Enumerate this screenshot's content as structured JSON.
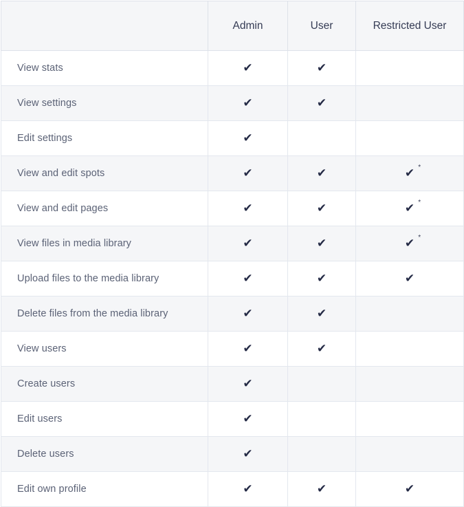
{
  "table": {
    "columns": [
      {
        "key": "feature",
        "label": ""
      },
      {
        "key": "admin",
        "label": "Admin"
      },
      {
        "key": "user",
        "label": "User"
      },
      {
        "key": "restricted",
        "label": "Restricted User"
      }
    ],
    "check_glyph": "✔",
    "footnote_marker": "*",
    "colors": {
      "header_background": "#f5f6f8",
      "row_alt_background": "#f5f6f8",
      "row_background": "#ffffff",
      "border": "#e3e7ee",
      "header_border": "#dde1e9",
      "header_text": "#343b54",
      "body_text": "#5b6276",
      "check_mark": "#252b46"
    },
    "rows": [
      {
        "feature": "View stats",
        "admin": "check",
        "user": "check",
        "restricted": ""
      },
      {
        "feature": "View settings",
        "admin": "check",
        "user": "check",
        "restricted": ""
      },
      {
        "feature": "Edit settings",
        "admin": "check",
        "user": "",
        "restricted": ""
      },
      {
        "feature": "View and edit spots",
        "admin": "check",
        "user": "check",
        "restricted": "check-note"
      },
      {
        "feature": "View and edit pages",
        "admin": "check",
        "user": "check",
        "restricted": "check-note"
      },
      {
        "feature": "View files in media library",
        "admin": "check",
        "user": "check",
        "restricted": "check-note"
      },
      {
        "feature": "Upload files to the media library",
        "admin": "check",
        "user": "check",
        "restricted": "check"
      },
      {
        "feature": "Delete files from the media library",
        "admin": "check",
        "user": "check",
        "restricted": ""
      },
      {
        "feature": "View users",
        "admin": "check",
        "user": "check",
        "restricted": ""
      },
      {
        "feature": "Create users",
        "admin": "check",
        "user": "",
        "restricted": ""
      },
      {
        "feature": "Edit users",
        "admin": "check",
        "user": "",
        "restricted": ""
      },
      {
        "feature": "Delete users",
        "admin": "check",
        "user": "",
        "restricted": ""
      },
      {
        "feature": "Edit own profile",
        "admin": "check",
        "user": "check",
        "restricted": "check"
      }
    ]
  }
}
